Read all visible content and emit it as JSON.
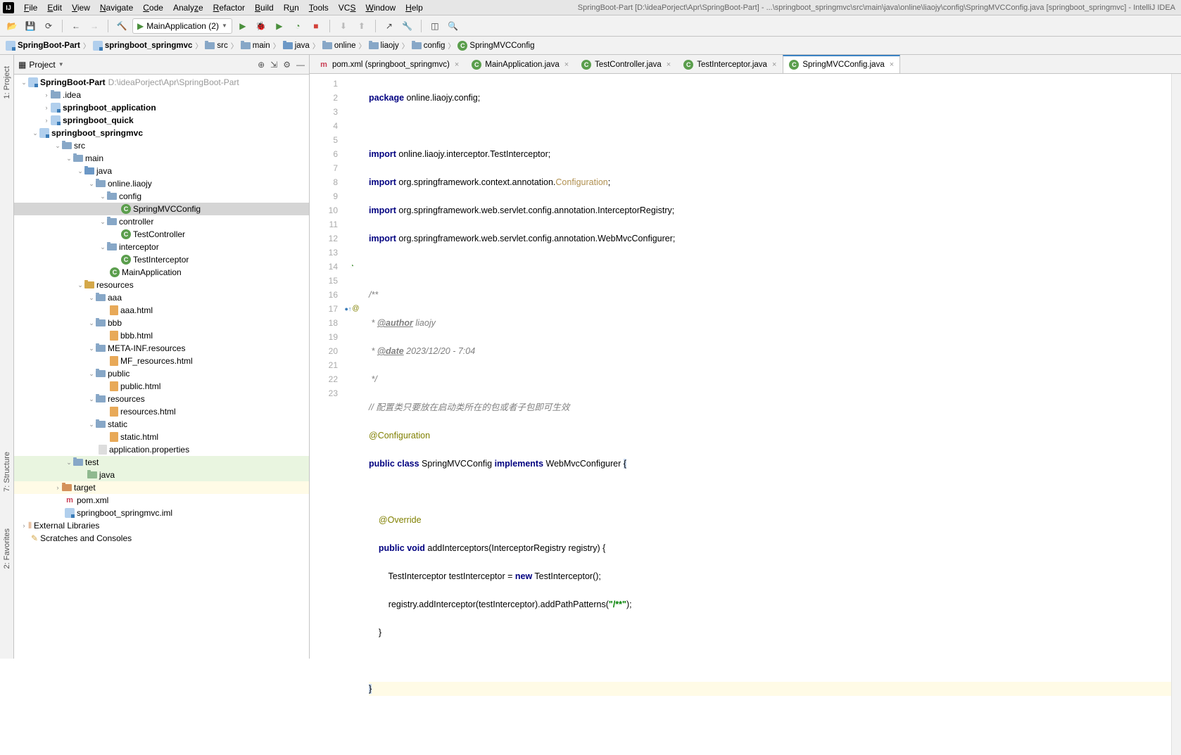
{
  "title_bar": {
    "window_title": "SpringBoot-Part [D:\\ideaPorject\\Apr\\SpringBoot-Part] - ...\\springboot_springmvc\\src\\main\\java\\online\\liaojy\\config\\SpringMVCConfig.java [springboot_springmvc] - IntelliJ IDEA",
    "menus": [
      "File",
      "Edit",
      "View",
      "Navigate",
      "Code",
      "Analyze",
      "Refactor",
      "Build",
      "Run",
      "Tools",
      "VCS",
      "Window",
      "Help"
    ]
  },
  "toolbar": {
    "run_config": "MainApplication (2)"
  },
  "breadcrumbs": [
    "SpringBoot-Part",
    "springboot_springmvc",
    "src",
    "main",
    "java",
    "online",
    "liaojy",
    "config",
    "SpringMVCConfig"
  ],
  "project_panel": {
    "title": "Project",
    "root": {
      "name": "SpringBoot-Part",
      "path": "D:\\ideaPorject\\Apr\\SpringBoot-Part"
    },
    "tree": {
      "idea": ".idea",
      "mod1": "springboot_application",
      "mod2": "springboot_quick",
      "mod3": "springboot_springmvc",
      "src": "src",
      "main": "main",
      "java": "java",
      "pkg": "online.liaojy",
      "config": "config",
      "config_file": "SpringMVCConfig",
      "controller": "controller",
      "controller_file": "TestController",
      "interceptor": "interceptor",
      "interceptor_file": "TestInterceptor",
      "main_app": "MainApplication",
      "resources": "resources",
      "aaa": "aaa",
      "aaa_file": "aaa.html",
      "bbb": "bbb",
      "bbb_file": "bbb.html",
      "metainf": "META-INF.resources",
      "mf_file": "MF_resources.html",
      "public": "public",
      "public_file": "public.html",
      "res2": "resources",
      "res2_file": "resources.html",
      "static": "static",
      "static_file": "static.html",
      "app_props": "application.properties",
      "test": "test",
      "test_java": "java",
      "target": "target",
      "pom": "pom.xml",
      "iml": "springboot_springmvc.iml"
    },
    "ext_lib": "External Libraries",
    "scratches": "Scratches and Consoles"
  },
  "editor_tabs": [
    {
      "label": "pom.xml (springboot_springmvc)",
      "type": "m"
    },
    {
      "label": "MainApplication.java",
      "type": "c"
    },
    {
      "label": "TestController.java",
      "type": "c"
    },
    {
      "label": "TestInterceptor.java",
      "type": "c"
    },
    {
      "label": "SpringMVCConfig.java",
      "type": "c",
      "active": true
    }
  ],
  "code": {
    "l1": {
      "kw": "package",
      "rest": " online.liaojy.config;"
    },
    "l3": {
      "kw": "import",
      "rest": " online.liaojy.interceptor.TestInterceptor;"
    },
    "l4": {
      "kw": "import",
      "rest": " org.springframework.context.annotation.",
      "cfg": "Configuration",
      "end": ";"
    },
    "l5": {
      "kw": "import",
      "rest": " org.springframework.web.servlet.config.annotation.InterceptorRegistry;"
    },
    "l6": {
      "kw": "import",
      "rest": " org.springframework.web.servlet.config.annotation.WebMvcConfigurer;"
    },
    "l8": "/**",
    "l9a": " * ",
    "l9tag": "@author",
    "l9b": " liaojy",
    "l10a": " * ",
    "l10tag": "@date",
    "l10b": " 2023/12/20 - 7:04",
    "l11": " */",
    "l12": "// 配置类只要放在启动类所在的包或者子包即可生效",
    "l13": "@Configuration",
    "l14a": "public",
    "l14b": "class",
    "l14c": " SpringMVCConfig ",
    "l14d": "implements",
    "l14e": " WebMvcConfigurer ",
    "l14f": "{",
    "l16": "@Override",
    "l17a": "public",
    "l17b": "void",
    "l17c": " addInterceptors(InterceptorRegistry registry) {",
    "l18a": "        TestInterceptor testInterceptor = ",
    "l18b": "new",
    "l18c": " TestInterceptor();",
    "l19a": "        registry.addInterceptor(testInterceptor).addPathPatterns(",
    "l19b": "\"/**\"",
    "l19c": ");",
    "l20": "    }",
    "l22": "}"
  },
  "line_count": 23,
  "gutter_labels": {
    "project": "1: Project",
    "structure": "7: Structure",
    "favorites": "2: Favorites"
  }
}
